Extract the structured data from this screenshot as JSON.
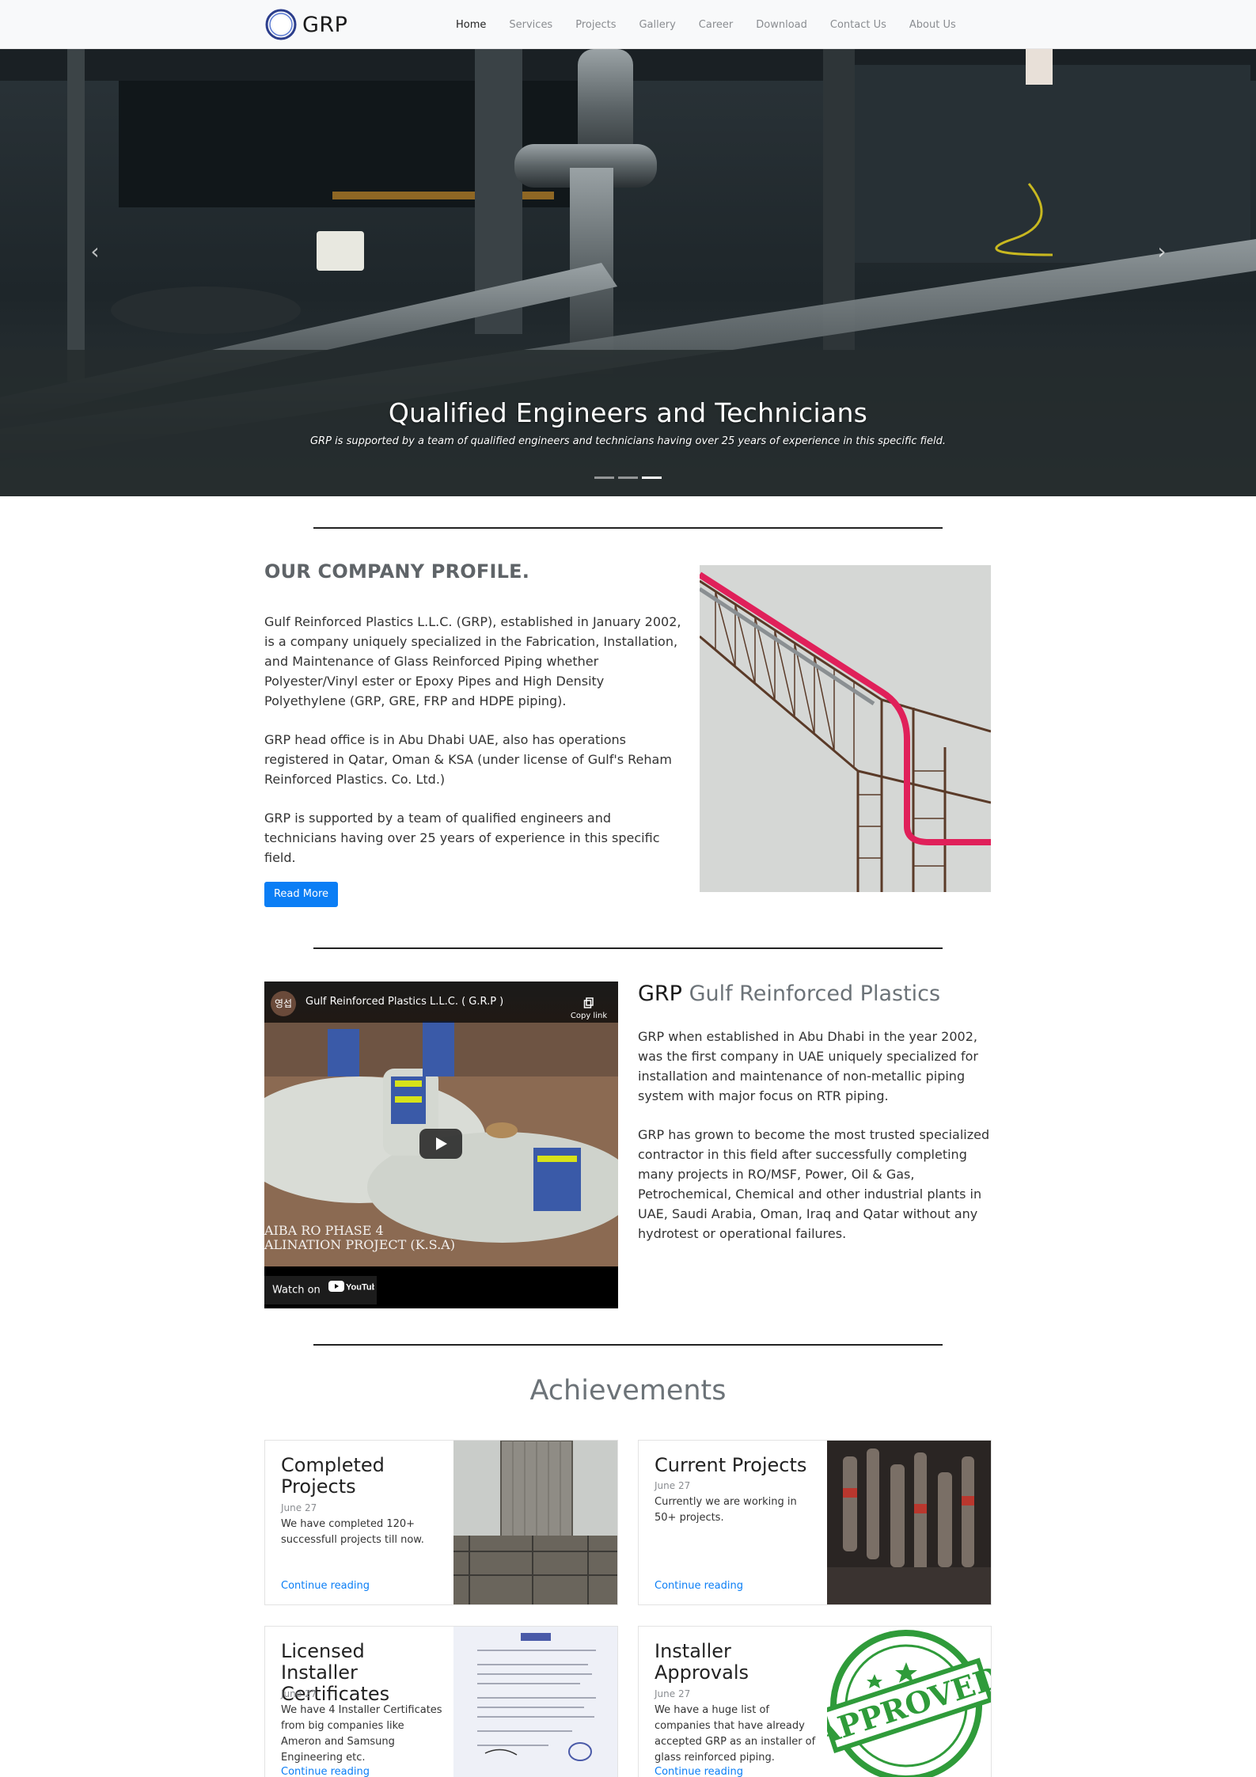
{
  "brand": {
    "name": "GRP"
  },
  "nav": [
    {
      "label": "Home",
      "active": true
    },
    {
      "label": "Services"
    },
    {
      "label": "Projects"
    },
    {
      "label": "Gallery"
    },
    {
      "label": "Career"
    },
    {
      "label": "Download"
    },
    {
      "label": "Contact Us"
    },
    {
      "label": "About Us"
    }
  ],
  "hero": {
    "title": "Qualified Engineers and Technicians",
    "caption": "GRP is supported by a team of qualified engineers and technicians having over 25 years of experience in this specific field.",
    "active_slide": 3,
    "slide_count": 3
  },
  "profile": {
    "heading": "OUR COMPANY PROFILE.",
    "paragraphs": [
      "Gulf Reinforced Plastics L.L.C. (GRP), established in January 2002, is a company uniquely specialized in the Fabrication, Installation, and Maintenance of Glass Reinforced Piping whether Polyester/Vinyl ester or Epoxy Pipes and High Density Polyethylene (GRP, GRE, FRP and HDPE piping).",
      "GRP head office is in Abu Dhabi UAE, also has operations registered in Qatar, Oman & KSA (under license of Gulf's Reham Reinforced Plastics. Co. Ltd.)",
      "GRP is supported by a team of qualified engineers and technicians having over 25 years of experience in this specific field."
    ],
    "button": "Read More"
  },
  "video": {
    "channel_avatar": "영섭",
    "title": "Gulf Reinforced Plastics L.L.C. ( G.R.P )",
    "copy_link": "Copy link",
    "overlay_line1": "AIBA RO PHASE 4",
    "overlay_line2": "ALINATION PROJECT (K.S.A)",
    "watch_on": "Watch on",
    "youtube": "YouTube"
  },
  "about": {
    "heading_bold": "GRP",
    "heading_light": "Gulf Reinforced Plastics",
    "paragraphs": [
      "GRP when established in Abu Dhabi in the year 2002, was the first company in UAE uniquely specialized for installation and maintenance of non-metallic piping system with major focus on RTR piping.",
      "GRP has grown to become the most trusted specialized contractor in this field after successfully completing many projects in RO/MSF, Power, Oil & Gas, Petrochemical, Chemical and other industrial plants in UAE, Saudi Arabia, Oman, Iraq and Qatar without any hydrotest or operational failures."
    ]
  },
  "achievements": {
    "heading": "Achievements",
    "cards": [
      {
        "title": "Completed Projects",
        "date": "June 27",
        "text": "We have completed 120+ successfull projects till now.",
        "link": "Continue reading"
      },
      {
        "title": "Current Projects",
        "date": "June 27",
        "text": "Currently we are working in 50+ projects.",
        "link": "Continue reading"
      },
      {
        "title": "Licensed Installer Certificates",
        "date": "June 27",
        "text": "We have 4 Installer Certificates from big companies like Ameron and Samsung Engineering etc.",
        "link": "Continue reading"
      },
      {
        "title": "Installer Approvals",
        "date": "June 27",
        "text": "We have a huge list of companies that have already accepted GRP as an installer of glass reinforced piping.",
        "link": "Continue reading",
        "stamp_text": "APPROVED"
      }
    ]
  },
  "colors": {
    "accent": "#0b7ef5",
    "heading_gray": "#6c7378",
    "nav_bg": "#f8f9fa"
  }
}
